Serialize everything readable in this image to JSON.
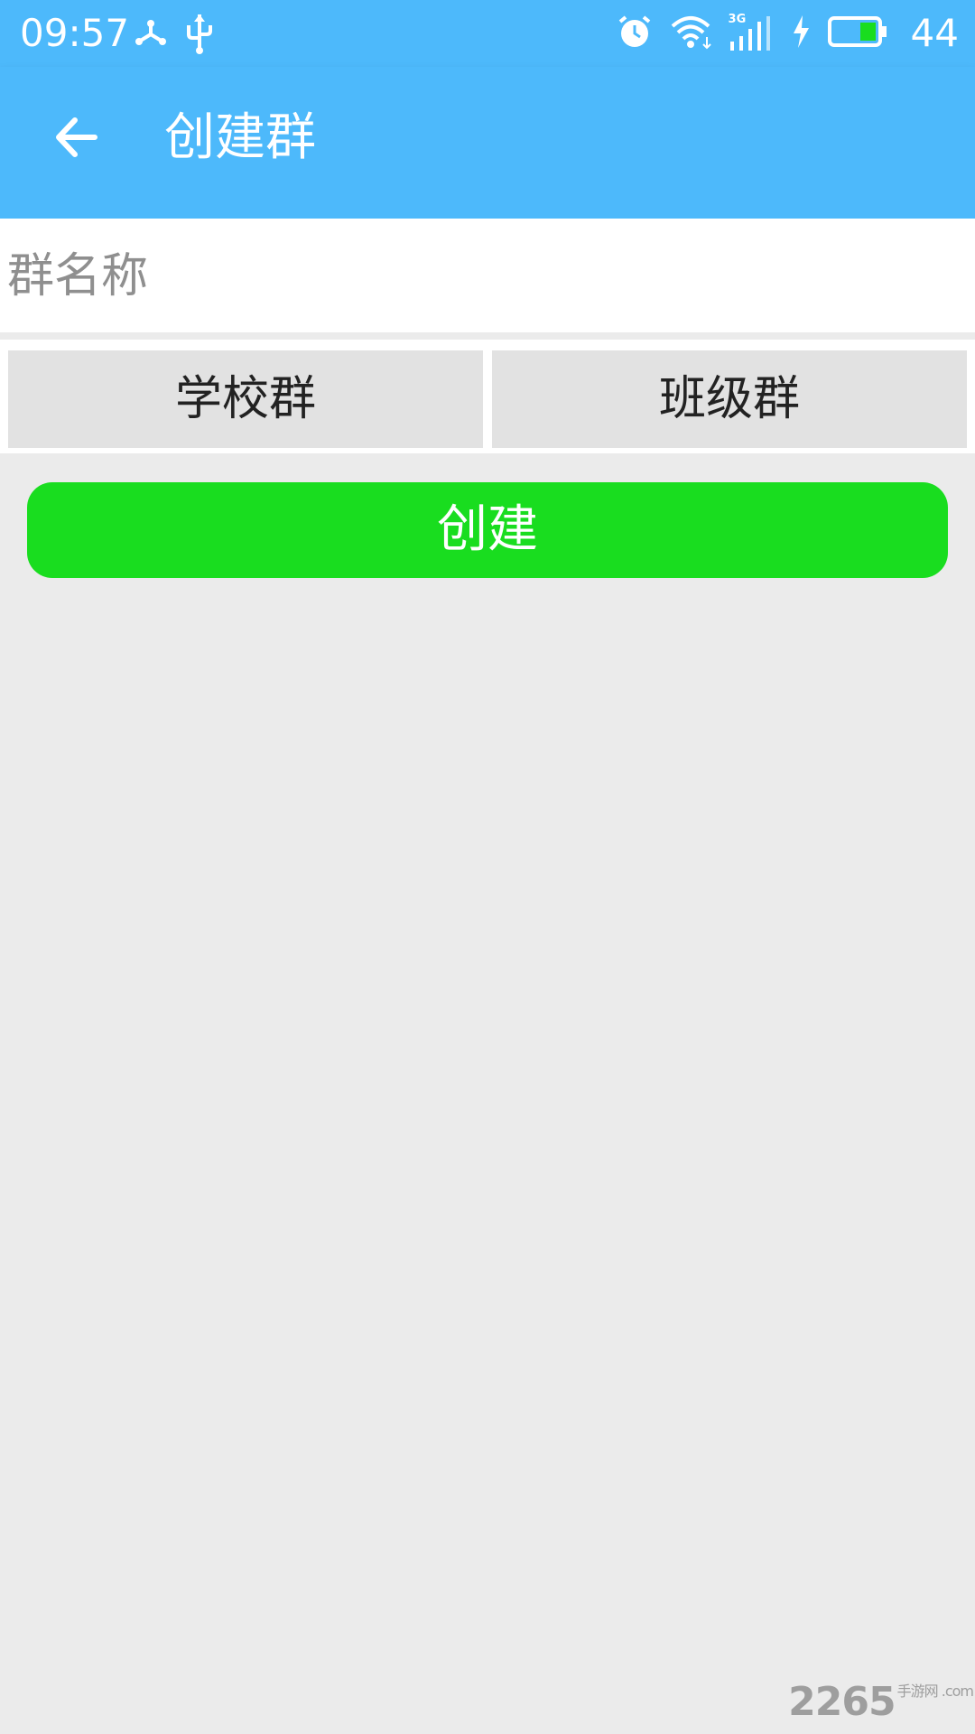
{
  "status_bar": {
    "time": "09:57",
    "icons_left": [
      "network-share-icon",
      "usb-icon"
    ],
    "icons_right": [
      "alarm-icon",
      "wifi-icon",
      "signal-3g-icon",
      "charging-icon",
      "battery-icon"
    ],
    "signal_label": "3G",
    "battery_level": "44"
  },
  "app_bar": {
    "title": "创建群",
    "back_icon": "arrow-left-icon"
  },
  "form": {
    "name_placeholder": "群名称",
    "type_options": [
      "学校群",
      "班级群"
    ],
    "create_label": "创建"
  },
  "watermark": {
    "brand": "2265",
    "suffix": "手游网 .com"
  },
  "colors": {
    "app_bar": "#4db9fb",
    "create_button": "#19dd1f",
    "background": "#ebebeb",
    "option_button": "#e2e2e2"
  }
}
